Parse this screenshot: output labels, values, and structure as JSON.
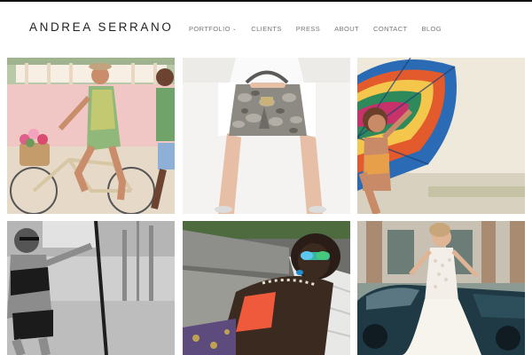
{
  "brand": {
    "name": "ANDREA SERRANO"
  },
  "nav": {
    "items": [
      {
        "label": "PORTFOLIO",
        "has_dropdown": true
      },
      {
        "label": "CLIENTS"
      },
      {
        "label": "PRESS"
      },
      {
        "label": "ABOUT"
      },
      {
        "label": "CONTACT"
      },
      {
        "label": "BLOG"
      }
    ]
  },
  "gallery": {
    "tiles": [
      {
        "subject": "two women riding bicycles with a flower basket"
      },
      {
        "subject": "snakeskin handbag held by model in white"
      },
      {
        "subject": "woman under colorful patterned umbrella"
      },
      {
        "subject": "black and white model in two-piece swimsuit"
      },
      {
        "subject": "model in sunglasses with necklace reclining"
      },
      {
        "subject": "bride in lace gown beside vintage car"
      }
    ]
  },
  "colors": {
    "accent": "#111111",
    "nav_text": "#777777",
    "logo_text": "#222222"
  }
}
